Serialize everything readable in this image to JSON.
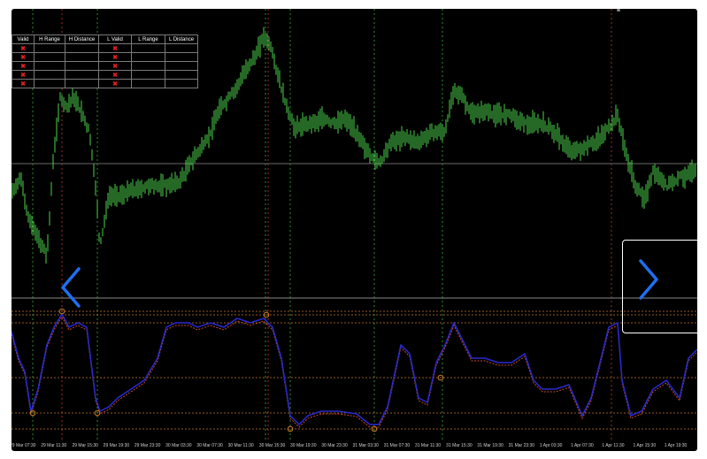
{
  "status_table": {
    "headers": [
      "Valid",
      "H Range",
      "H Distance",
      "L Valid",
      "L Range",
      "L Distance"
    ],
    "rows": [
      [
        "✖",
        "",
        "",
        "✖",
        "",
        ""
      ],
      [
        "✖",
        "",
        "",
        "✖",
        "",
        ""
      ],
      [
        "✖",
        "",
        "",
        "✖",
        "",
        ""
      ],
      [
        "✖",
        "",
        "",
        "✖",
        "",
        ""
      ],
      [
        "✖",
        "",
        "",
        "✖",
        "",
        ""
      ]
    ]
  },
  "time_axis": {
    "labels": [
      "29 Mar 07:30",
      "29 Mar 11:30",
      "29 Mar 15:30",
      "29 Mar 19:30",
      "29 Mar 23:30",
      "30 Mar 03:30",
      "30 Mar 07:30",
      "30 Mar 11:30",
      "30 Mar 15:30",
      "30 Mar 19:30",
      "30 Mar 23:30",
      "31 Mar 03:30",
      "31 Mar 07:30",
      "31 Mar 11:30",
      "31 Mar 15:30",
      "31 Mar 19:30",
      "31 Mar 23:30",
      "1 Apr 03:30",
      "1 Apr 07:30",
      "1 Apr 11:30",
      "1 Apr 15:30",
      "1 Apr 19:30"
    ]
  },
  "navigation": {
    "prev_icon": "chevron-left-icon",
    "next_icon": "chevron-right-icon"
  },
  "colors": {
    "background": "#000000",
    "candles": "#4cd24c",
    "oscillator_main": "#2a2ad0",
    "oscillator_signal": "#c84a2a",
    "level_lines": "#c87a28",
    "nav_arrow": "#1e6ff0",
    "cross_mark": "#e02020"
  }
}
